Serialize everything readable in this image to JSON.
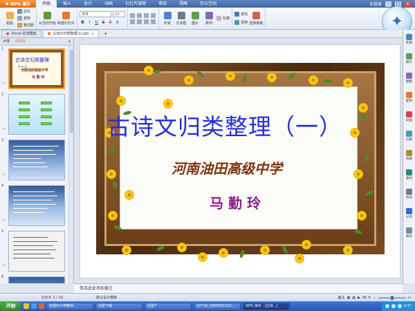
{
  "app": {
    "name": "WPS 演示"
  },
  "menubar": {
    "items": [
      "开始",
      "插入",
      "设计",
      "动画",
      "幻灯片放映",
      "审阅",
      "视图",
      "办公空间"
    ],
    "user": "未登录",
    "window_buttons": [
      "–",
      "□",
      "×"
    ]
  },
  "ribbon": {
    "paste": "粘贴",
    "cut": "剪切",
    "copy": "复制",
    "format_painter": "格式刷",
    "from_current": "从当前开始",
    "new_slide": "新建幻灯片",
    "font_name": "宋体",
    "font_size": "10",
    "format_buttons": [
      "B",
      "I",
      "U",
      "S",
      "A",
      "A"
    ],
    "shape": "形状",
    "textbox": "文本框",
    "picture": "图片",
    "arrange": "排列",
    "outline": "轮廓",
    "find": "查找",
    "replace": "替换",
    "select_pane": "选择窗格"
  },
  "tabs": {
    "items": [
      "Docer-在线模板",
      "古诗文归类整理(1).ppt"
    ],
    "add": "+"
  },
  "left_panel": {
    "tabs": [
      "大纲",
      "幻灯片"
    ],
    "close": "×",
    "slide_numbers": [
      "1",
      "2",
      "3",
      "4",
      "5",
      "6"
    ],
    "slide1_title": "古诗文归类整理（一）",
    "slide1_school": "河南油田高级中学",
    "slide1_author": "马 勤 玲"
  },
  "slide": {
    "title": "古诗文归类整理（一）",
    "school": "河南油田高级中学",
    "author": "马勤玲"
  },
  "right_bar": {
    "items": [
      "新建",
      "图片",
      "模板",
      "配色",
      "动画",
      "切换",
      "效果",
      "素材",
      "协作",
      "分享",
      "备份"
    ]
  },
  "notes": {
    "placeholder": "单击此处添加备注"
  },
  "statusbar": {
    "slide_info": "幻灯片 1 / 10",
    "template": "默认设计模板",
    "notes_toggle": "备注",
    "zoom": "45 %"
  },
  "taskbar": {
    "start": "开始",
    "tasks": [
      "全国中小学教师...",
      "迅雷下载",
      "迅雷7",
      "22716_2005052110...",
      "WPS 演示 - [古诗...]"
    ],
    "time": "9:47"
  },
  "colors": {
    "title": "#2430d0",
    "school": "#7a3410",
    "author": "#8a1f8a",
    "frame": "#6b3f17",
    "flower": "#f2b705"
  }
}
